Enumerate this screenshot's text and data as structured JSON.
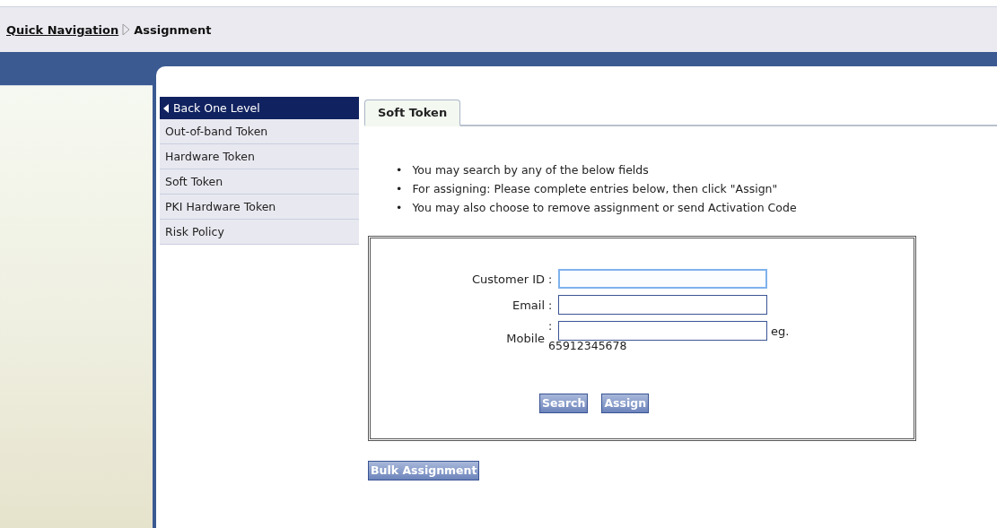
{
  "breadcrumb": {
    "link": "Quick Navigation",
    "current": "Assignment"
  },
  "sidebar": {
    "back": "Back One Level",
    "items": [
      {
        "label": "Out-of-band Token",
        "selected": false
      },
      {
        "label": "Hardware Token",
        "selected": false
      },
      {
        "label": "Soft Token",
        "selected": false
      },
      {
        "label": "PKI Hardware Token",
        "selected": false
      },
      {
        "label": "Risk Policy",
        "selected": false
      }
    ]
  },
  "tabs": [
    {
      "label": "Soft Token",
      "selected": true
    }
  ],
  "instructions": [
    {
      "bullet": "•",
      "text": "You may search by any of the below fields"
    },
    {
      "bullet": "•",
      "text": "For assigning: Please complete entries below, then click \"Assign\""
    },
    {
      "bullet": "•",
      "text": "You may also choose to remove assignment or send Activation Code"
    }
  ],
  "form": {
    "fields": [
      {
        "label": "Customer ID",
        "colon": ":",
        "focused": true
      },
      {
        "label": "Email",
        "colon": ":",
        "focused": false
      },
      {
        "label": "Mobile",
        "colon": ":",
        "focused": false,
        "hint": "eg.",
        "example": "65912345678"
      }
    ],
    "buttons": [
      "Search",
      "Assign"
    ]
  },
  "bulk_button": "Bulk Assignment"
}
